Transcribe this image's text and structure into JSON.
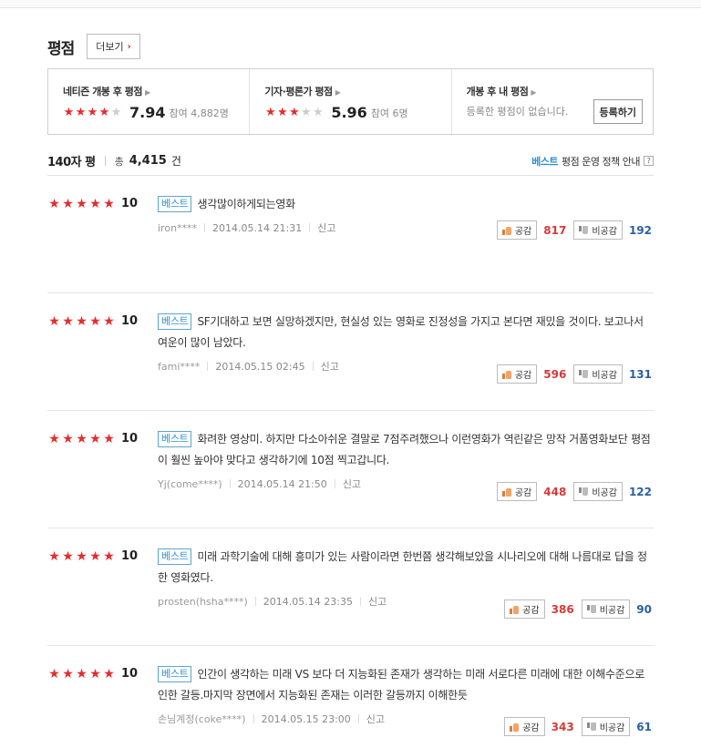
{
  "section": {
    "title": "평점",
    "more_label": "더보기"
  },
  "summary": [
    {
      "title": "네티즌 개봉 후 평점",
      "stars": 4,
      "score": "7.94",
      "participants": "참여 4,882명"
    },
    {
      "title": "기자·평론가 평점",
      "stars": 3,
      "score": "5.96",
      "participants": "참여 6명"
    },
    {
      "title": "개봉 후 내 평점",
      "empty_text": "등록한 평점이 없습니다.",
      "register_label": "등록하기"
    }
  ],
  "count": {
    "title": "140자 평",
    "total_label": "총",
    "total": "4,415",
    "unit": "건"
  },
  "policy": {
    "best": "베스트",
    "text": "평점 운영 정책 안내",
    "help": "?"
  },
  "best_label": "베스트",
  "like_label": "공감",
  "dislike_label": "비공감",
  "report_label": "신고",
  "reviews": [
    {
      "score": "10",
      "stars": 5,
      "text": "생각많이하게되는영화",
      "user": "iron****",
      "date": "2014.05.14 21:31",
      "likes": "817",
      "dislikes": "192"
    },
    {
      "score": "10",
      "stars": 5,
      "text": "SF기대하고 보면 실망하겠지만, 현실성 있는 영화로 진정성을 가지고 본다면 재밌을 것이다. 보고나서 여운이 많이 남았다.",
      "user": "fami****",
      "date": "2014.05.15 02:45",
      "likes": "596",
      "dislikes": "131"
    },
    {
      "score": "10",
      "stars": 5,
      "text": "화려한 영상미. 하지만 다소아쉬운 결말로 7점주려했으나 이런영화가 역린같은 망작 거품영화보단 평점이 훨씬 높아야 맞다고 생각하기에 10점 찍고갑니다.",
      "user": "Yj(come****)",
      "date": "2014.05.14 21:50",
      "likes": "448",
      "dislikes": "122"
    },
    {
      "score": "10",
      "stars": 5,
      "text": "미래 과학기술에 대해 흥미가 있는 사람이라면 한번쯤 생각해보았을 시나리오에 대해 나름대로 답을 정한 영화였다.",
      "user": "prosten(hsha****)",
      "date": "2014.05.14 23:35",
      "likes": "386",
      "dislikes": "90"
    },
    {
      "score": "10",
      "stars": 5,
      "text": "인간이 생각하는 미래 VS 보다 더 지능화된 존재가 생각하는 미래 서로다른 미래에 대한 이해수준으로 인한 갈등.마지막 장면에서 지능화된 존재는 이러한 갈등까지 이해한듯",
      "user": "손님계정(coke****)",
      "date": "2014.05.15 23:00",
      "likes": "343",
      "dislikes": "61"
    }
  ]
}
